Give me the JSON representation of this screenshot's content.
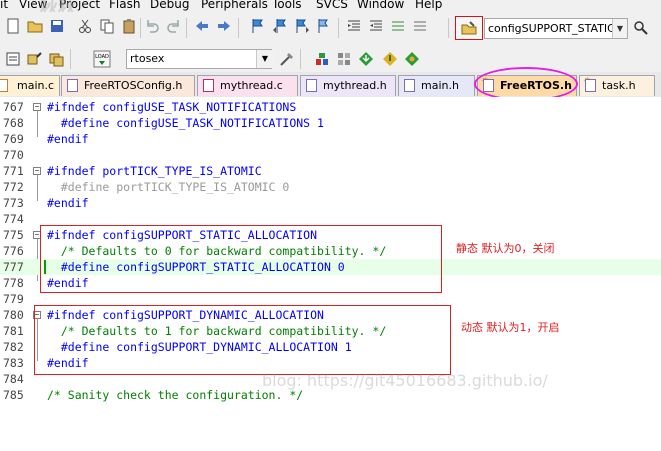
{
  "menu": {
    "items": [
      "it",
      "View",
      "Project",
      "Flash",
      "Debug",
      "Peripherals",
      "Tools",
      "SVCS",
      "Window",
      "Help"
    ]
  },
  "toolbar1": {
    "find_combo_value": "configSUPPORT_STATIC_A"
  },
  "toolbar2": {
    "target_value": "rtosex"
  },
  "tabs": [
    {
      "label": "main.c",
      "active": false
    },
    {
      "label": "FreeRTOSConfig.h",
      "active": false
    },
    {
      "label": "mythread.c",
      "active": false
    },
    {
      "label": "mythread.h",
      "active": false
    },
    {
      "label": "main.h",
      "active": false
    },
    {
      "label": "FreeRTOS.h",
      "active": true
    },
    {
      "label": "task.h",
      "active": false
    }
  ],
  "editor": {
    "lines": [
      {
        "num": "767",
        "text": "#ifndef configUSE_TASK_NOTIFICATIONS"
      },
      {
        "num": "768",
        "text": "  #define configUSE_TASK_NOTIFICATIONS 1"
      },
      {
        "num": "769",
        "text": "#endif"
      },
      {
        "num": "770",
        "text": ""
      },
      {
        "num": "771",
        "text": "#ifndef portTICK_TYPE_IS_ATOMIC"
      },
      {
        "num": "772",
        "text": "  #define portTICK_TYPE_IS_ATOMIC 0"
      },
      {
        "num": "773",
        "text": "#endif"
      },
      {
        "num": "774",
        "text": ""
      },
      {
        "num": "775",
        "text": "#ifndef configSUPPORT_STATIC_ALLOCATION"
      },
      {
        "num": "776",
        "text": "  /* Defaults to 0 for backward compatibility. */"
      },
      {
        "num": "777",
        "text": "  #define configSUPPORT_STATIC_ALLOCATION 0"
      },
      {
        "num": "778",
        "text": "#endif"
      },
      {
        "num": "779",
        "text": ""
      },
      {
        "num": "780",
        "text": "#ifndef configSUPPORT_DYNAMIC_ALLOCATION"
      },
      {
        "num": "781",
        "text": "  /* Defaults to 1 for backward compatibility. */"
      },
      {
        "num": "782",
        "text": "  #define configSUPPORT_DYNAMIC_ALLOCATION 1"
      },
      {
        "num": "783",
        "text": "#endif"
      },
      {
        "num": "784",
        "text": ""
      },
      {
        "num": "785",
        "text": "/* Sanity check the configuration. */"
      }
    ]
  },
  "annotations": {
    "static_note": "静态  默认为0，关闭",
    "dynamic_note": "动态  默认为1，开启"
  },
  "watermark": "blog: https://git45016683.github.io/",
  "colors": {
    "preprocessor": "#0000ff",
    "comment": "#008000",
    "number": "#000080",
    "inactive": "#9a9a9a",
    "annotation": "#e02020",
    "active_tab": "#ffd9a6",
    "highlight_circle": "#e61ee6"
  }
}
